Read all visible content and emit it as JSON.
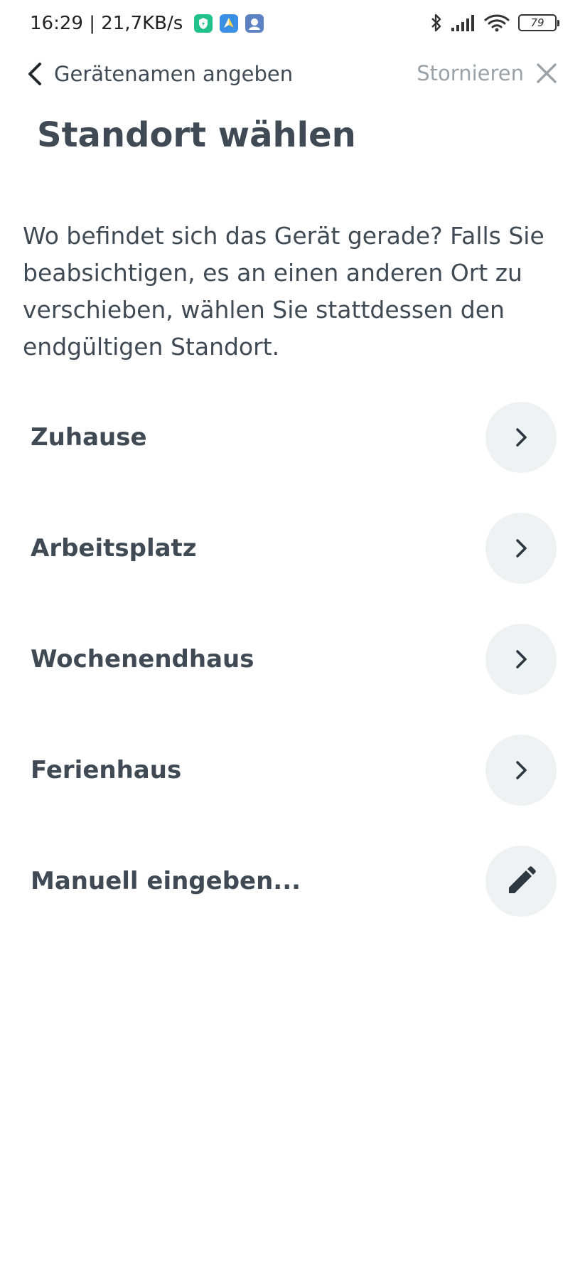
{
  "status_bar": {
    "time_and_speed": "16:29 | 21,7KB/s",
    "battery": "79"
  },
  "nav": {
    "back_label": "Gerätenamen angeben",
    "cancel_label": "Stornieren"
  },
  "page": {
    "title": "Standort wählen",
    "description": "Wo befindet sich das Gerät gerade? Falls Sie beabsichtigen, es an einen anderen Ort zu verschieben, wählen Sie stattdessen den endgültigen Standort."
  },
  "locations": [
    {
      "label": "Zuhause",
      "icon": "chevron-right-icon"
    },
    {
      "label": "Arbeitsplatz",
      "icon": "chevron-right-icon"
    },
    {
      "label": "Wochenendhaus",
      "icon": "chevron-right-icon"
    },
    {
      "label": "Ferienhaus",
      "icon": "chevron-right-icon"
    },
    {
      "label": "Manuell eingeben...",
      "icon": "pencil-icon"
    }
  ],
  "colors": {
    "text": "#3f4a55",
    "muted": "#9aa2a8",
    "circle_bg": "#eef2f3"
  }
}
